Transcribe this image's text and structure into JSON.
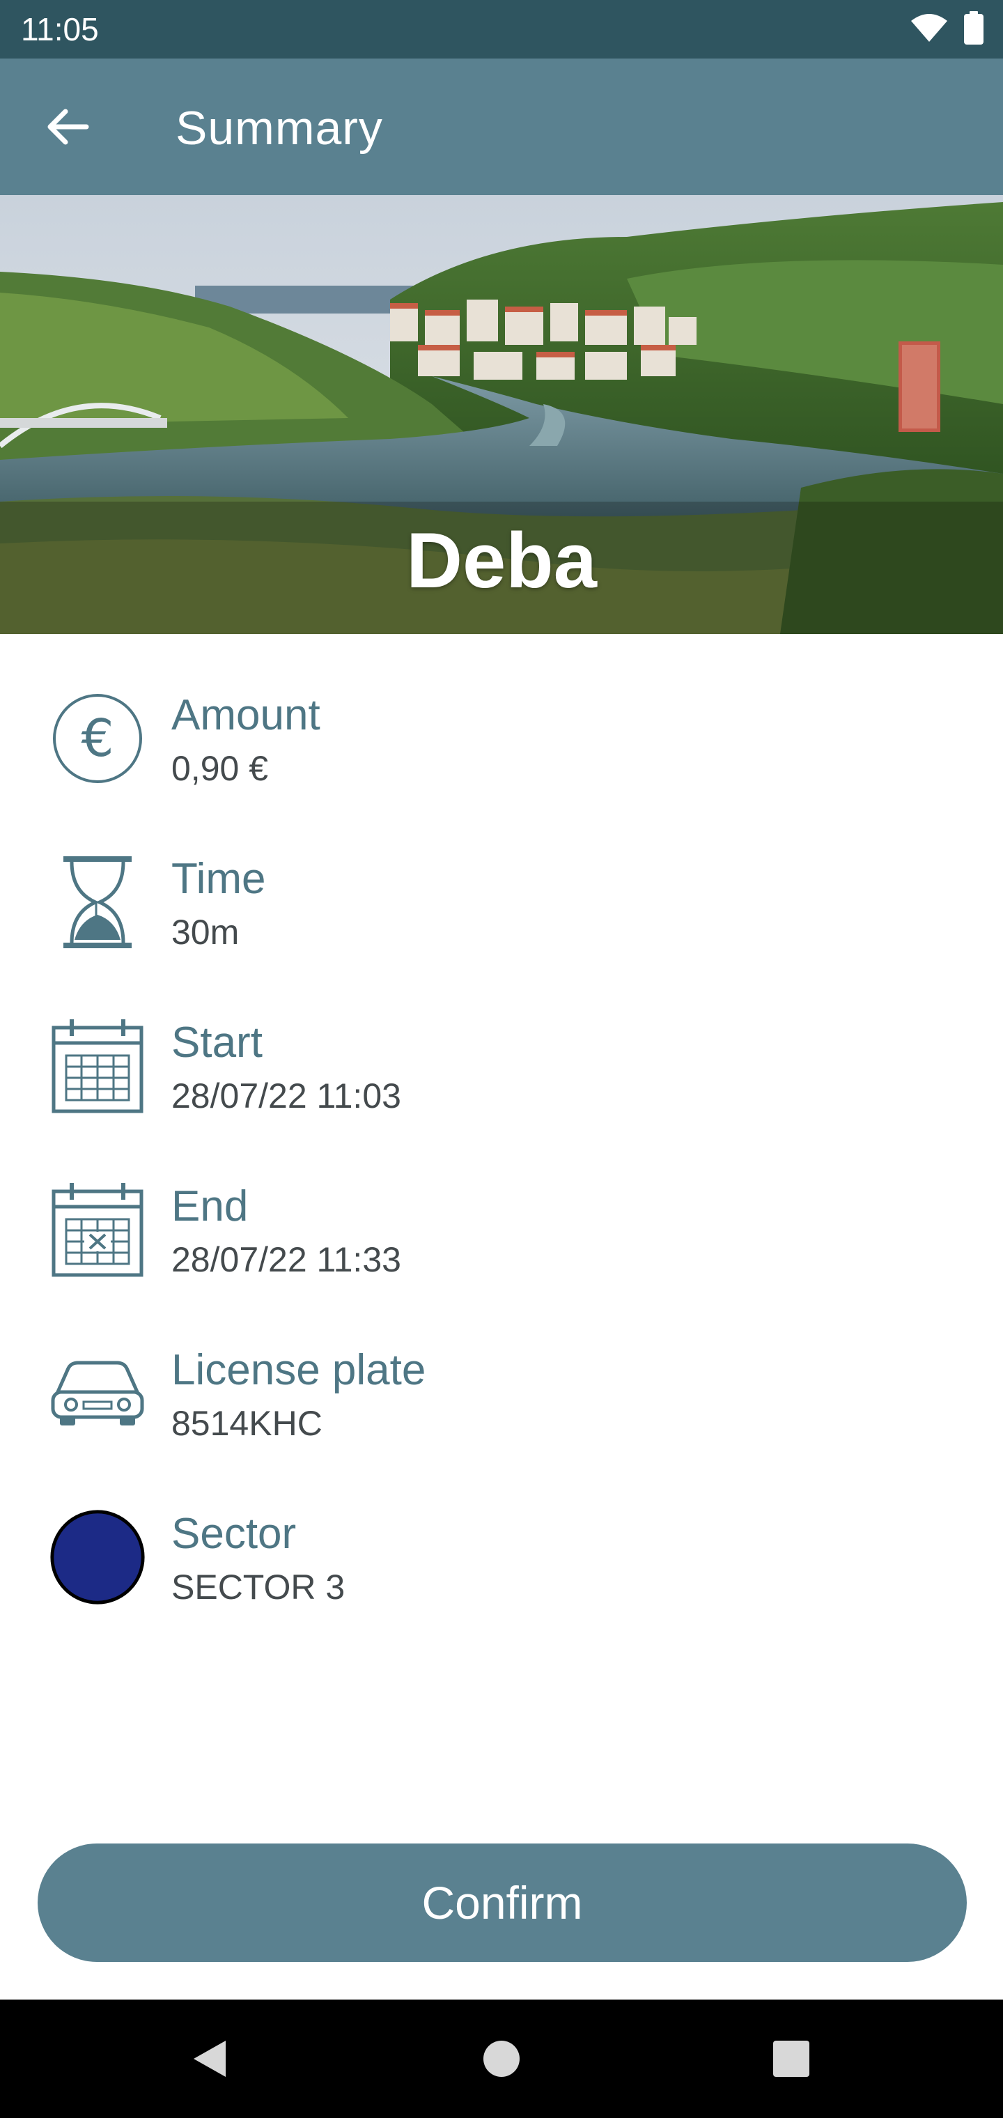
{
  "status_bar": {
    "time": "11:05",
    "icons": [
      "wifi-icon",
      "battery-icon"
    ]
  },
  "app_bar": {
    "title": "Summary",
    "back_icon": "arrow-left-icon"
  },
  "hero": {
    "location": "Deba"
  },
  "details": [
    {
      "id": "amount",
      "label": "Amount",
      "value": "0,90 €",
      "icon": "euro-icon"
    },
    {
      "id": "time",
      "label": "Time",
      "value": "30m",
      "icon": "hourglass-icon"
    },
    {
      "id": "start",
      "label": "Start",
      "value": "28/07/22 11:03",
      "icon": "calendar-icon"
    },
    {
      "id": "end",
      "label": "End",
      "value": "28/07/22 11:33",
      "icon": "calendar-x-icon"
    },
    {
      "id": "license_plate",
      "label": "License plate",
      "value": "8514KHC",
      "icon": "car-icon"
    },
    {
      "id": "sector",
      "label": "Sector",
      "value": "SECTOR 3",
      "icon": "sector-color-dot",
      "color": "#1c2a86"
    }
  ],
  "actions": {
    "confirm_label": "Confirm"
  },
  "nav_bar": {
    "icons": [
      "back-triangle-icon",
      "home-circle-icon",
      "recents-square-icon"
    ]
  },
  "colors": {
    "primary": "#5a8190",
    "status_bar": "#2f5560",
    "label_text": "#4e7684",
    "sector": "#1c2a86"
  }
}
